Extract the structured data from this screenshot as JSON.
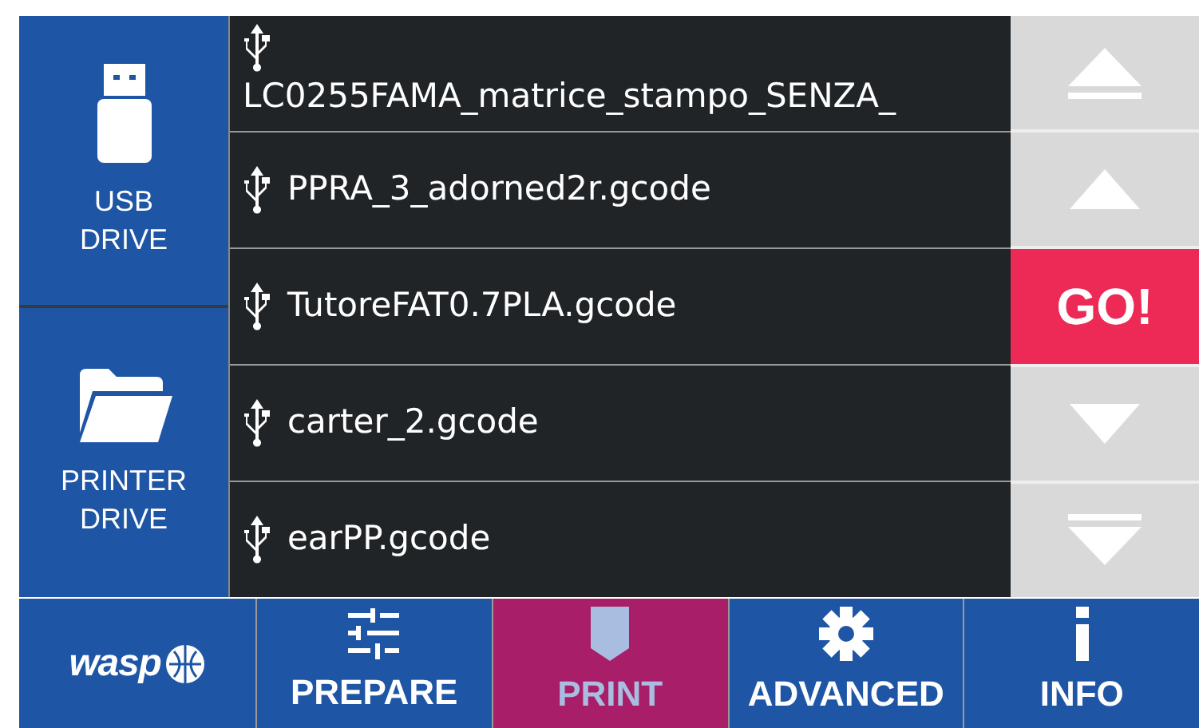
{
  "sources": [
    {
      "label": "USB DRIVE",
      "kind": "usb"
    },
    {
      "label": "PRINTER DRIVE",
      "kind": "folder"
    }
  ],
  "files": [
    {
      "name": "LC0255FAMA_matrice_stampo_SENZA_",
      "wrapped": true
    },
    {
      "name": "PPRA_3_adorned2r.gcode",
      "wrapped": false
    },
    {
      "name": "TutoreFAT0.7PLA.gcode",
      "wrapped": false
    },
    {
      "name": "carter_2.gcode",
      "wrapped": false
    },
    {
      "name": "earPP.gcode",
      "wrapped": false
    }
  ],
  "controls": [
    {
      "kind": "top"
    },
    {
      "kind": "up"
    },
    {
      "kind": "go",
      "label": "GO!"
    },
    {
      "kind": "down"
    },
    {
      "kind": "bottom"
    }
  ],
  "nav": {
    "logo": "wasp",
    "tabs": [
      {
        "label": "PREPARE",
        "kind": "sliders",
        "selected": false
      },
      {
        "label": "PRINT",
        "kind": "print",
        "selected": true
      },
      {
        "label": "ADVANCED",
        "kind": "gear",
        "selected": false
      },
      {
        "label": "INFO",
        "kind": "info",
        "selected": false
      }
    ]
  }
}
